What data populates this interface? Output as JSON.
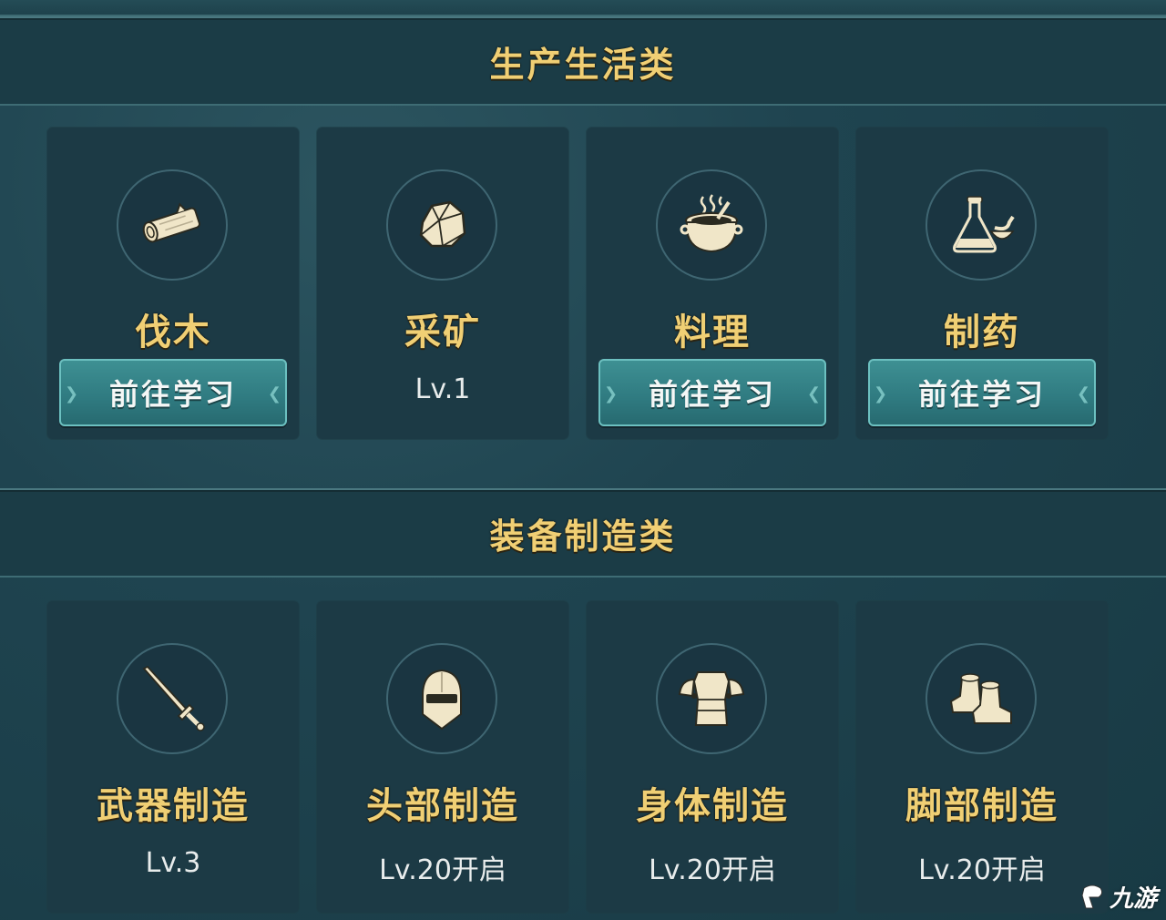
{
  "sections": [
    {
      "title": "生产生活类",
      "cards": [
        {
          "name": "伐木",
          "icon": "log-icon",
          "action": "前往学习"
        },
        {
          "name": "采矿",
          "icon": "ore-icon",
          "level": "Lv.1"
        },
        {
          "name": "料理",
          "icon": "cooking-pot-icon",
          "action": "前往学习"
        },
        {
          "name": "制药",
          "icon": "potion-flask-icon",
          "action": "前往学习"
        }
      ]
    },
    {
      "title": "装备制造类",
      "cards": [
        {
          "name": "武器制造",
          "icon": "sword-icon",
          "level": "Lv.3"
        },
        {
          "name": "头部制造",
          "icon": "helmet-icon",
          "level": "Lv.20开启"
        },
        {
          "name": "身体制造",
          "icon": "armor-icon",
          "level": "Lv.20开启"
        },
        {
          "name": "脚部制造",
          "icon": "boots-icon",
          "level": "Lv.20开启"
        }
      ]
    }
  ],
  "watermark": {
    "text": "九游"
  },
  "colors": {
    "title_gold": "#f0cf74",
    "button_teal": "#2f7a80",
    "card_bg": "#1c3a45"
  }
}
